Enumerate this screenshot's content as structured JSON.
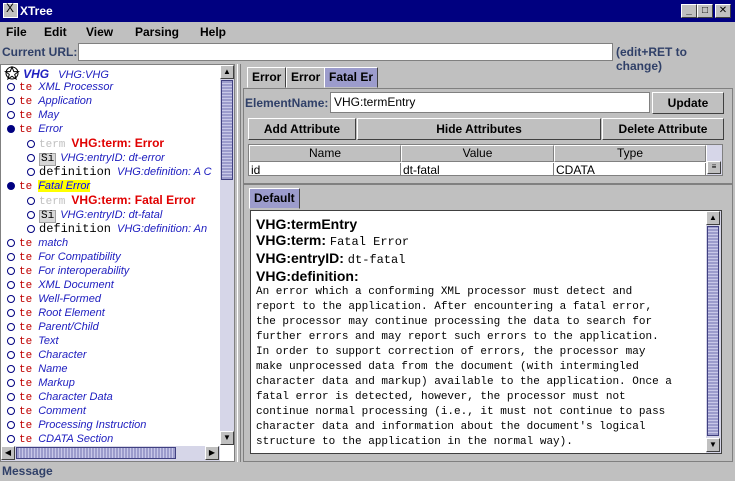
{
  "window": {
    "title": "XTree",
    "minimize": "_",
    "maximize": "□",
    "close": "✕"
  },
  "menu": [
    "File",
    "Edit",
    "View",
    "Parsing",
    "Help"
  ],
  "url": {
    "label": "Current URL:",
    "value": "",
    "hint": "(edit+RET to change)"
  },
  "tree": {
    "root": {
      "icon": "VHG",
      "label": "VHG:VHG"
    },
    "items": [
      {
        "kind": "te",
        "label": "XML Processor"
      },
      {
        "kind": "te",
        "label": "Application"
      },
      {
        "kind": "te",
        "label": "May"
      },
      {
        "kind": "te",
        "label": "Error",
        "expanded": true
      },
      {
        "kind": "term",
        "ghost": "term",
        "label": "VHG:term: Error"
      },
      {
        "kind": "si",
        "tag": "Si",
        "label": "VHG:entryID: dt-error"
      },
      {
        "kind": "def",
        "tag": "definition",
        "label": "VHG:definition: A C"
      },
      {
        "kind": "te",
        "label": "Fatal Error",
        "selected": true,
        "expanded": true
      },
      {
        "kind": "term",
        "ghost": "term",
        "label": "VHG:term: Fatal Error"
      },
      {
        "kind": "si",
        "tag": "Si",
        "label": "VHG:entryID: dt-fatal"
      },
      {
        "kind": "def",
        "tag": "definition",
        "label": "VHG:definition: An"
      },
      {
        "kind": "te",
        "label": "match"
      },
      {
        "kind": "te",
        "label": "For Compatibility"
      },
      {
        "kind": "te",
        "label": "For interoperability"
      },
      {
        "kind": "te",
        "label": "XML Document"
      },
      {
        "kind": "te",
        "label": "Well-Formed"
      },
      {
        "kind": "te",
        "label": "Root Element"
      },
      {
        "kind": "te",
        "label": "Parent/Child"
      },
      {
        "kind": "te",
        "label": "Text"
      },
      {
        "kind": "te",
        "label": "Character"
      },
      {
        "kind": "te",
        "label": "Name"
      },
      {
        "kind": "te",
        "label": "Markup"
      },
      {
        "kind": "te",
        "label": "Character Data"
      },
      {
        "kind": "te",
        "label": "Comment"
      },
      {
        "kind": "te",
        "label": "Processing Instruction"
      },
      {
        "kind": "te",
        "label": "CDATA Section"
      }
    ],
    "te_tag": "te"
  },
  "tabs": [
    "Error",
    "Error",
    "Fatal Er"
  ],
  "element": {
    "label": "ElementName:",
    "value": "VHG:termEntry",
    "update": "Update"
  },
  "attr_buttons": {
    "add": "Add Attribute",
    "hide": "Hide Attributes",
    "delete": "Delete Attribute"
  },
  "attr_table": {
    "headers": [
      "Name",
      "Value",
      "Type"
    ],
    "rows": [
      [
        "id",
        "dt-fatal",
        "CDATA"
      ]
    ]
  },
  "doc_tab": "Default",
  "doc": {
    "entry": "VHG:termEntry",
    "term_label": "VHG:term:",
    "term_value": "Fatal Error",
    "id_label": "VHG:entryID:",
    "id_value": "dt-fatal",
    "def_label": "VHG:definition:",
    "lines": [
      "An error which a conforming XML processor must detect and",
      "report to the application. After encountering a fatal error,",
      "the processor may continue processing the data to search for",
      "further errors and may report such errors to the application.",
      "In order to support correction of errors, the processor may",
      "make unprocessed data from the document (with intermingled",
      "character data and markup) available to the application. Once a",
      "fatal error is detected, however, the processor must not",
      "continue normal processing (i.e., it must not continue to pass",
      "character data and information about the document's logical",
      "structure to the application in the normal way)."
    ]
  },
  "status": "Message",
  "colors": {
    "titlebar": "#000080",
    "accent": "#9c9ccc",
    "tree_text": "#2020c0",
    "te_tag": "#c00000",
    "highlight": "#ffff00"
  }
}
